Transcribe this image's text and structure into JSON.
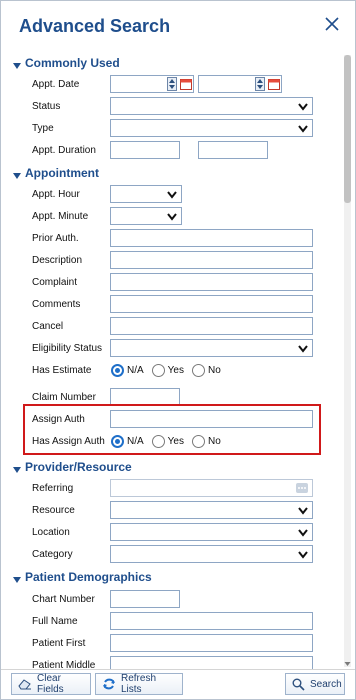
{
  "header": {
    "title": "Advanced Search"
  },
  "sections": {
    "commonly_used": "Commonly Used",
    "appointment": "Appointment",
    "provider_resource": "Provider/Resource",
    "patient_demographics": "Patient Demographics"
  },
  "fields": {
    "appt_date": "Appt. Date",
    "status": "Status",
    "type": "Type",
    "appt_duration": "Appt. Duration",
    "appt_hour": "Appt. Hour",
    "appt_minute": "Appt. Minute",
    "prior_auth": "Prior Auth.",
    "description": "Description",
    "complaint": "Complaint",
    "comments": "Comments",
    "cancel": "Cancel",
    "eligibility_status": "Eligibility Status",
    "has_estimate": "Has Estimate",
    "claim_number": "Claim Number",
    "assign_auth": "Assign Auth",
    "has_assign_auth": "Has Assign Auth",
    "referring": "Referring",
    "resource": "Resource",
    "location": "Location",
    "category": "Category",
    "chart_number": "Chart Number",
    "full_name": "Full Name",
    "patient_first": "Patient First",
    "patient_middle": "Patient Middle"
  },
  "radio_options": {
    "na": "N/A",
    "yes": "Yes",
    "no": "No"
  },
  "radio_state": {
    "has_estimate": "N/A",
    "has_assign_auth": "N/A"
  },
  "footer": {
    "clear_fields": "Clear Fields",
    "refresh_lists": "Refresh Lists",
    "search": "Search"
  },
  "icons": {
    "close": "close-icon",
    "section_toggle": "chevron-down-icon",
    "spinner": "spinner-icon",
    "calendar": "calendar-icon",
    "dropdown": "caret-down-icon",
    "lookup": "ellipsis-icon",
    "eraser": "eraser-icon",
    "refresh": "refresh-icon",
    "search": "search-icon"
  },
  "colors": {
    "accent": "#1f4e8c",
    "input_border": "#8ea6c4",
    "radio_selected": "#1f6fc9",
    "highlight": "#d0191a"
  }
}
